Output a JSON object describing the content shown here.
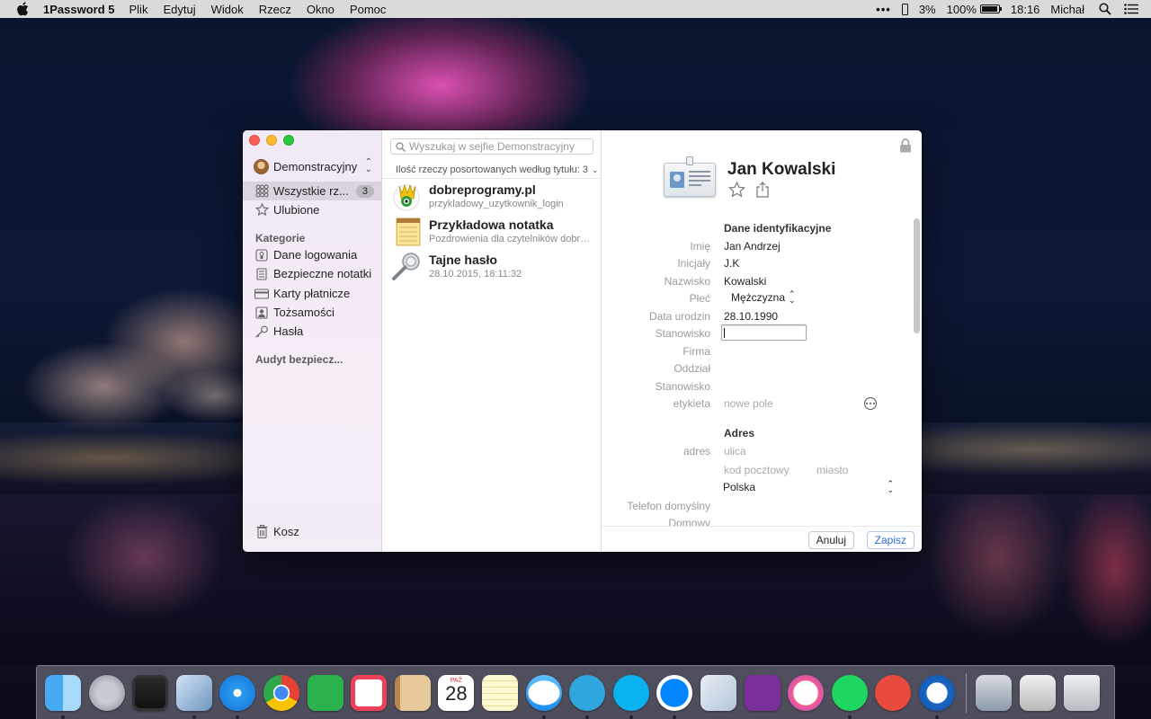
{
  "menubar": {
    "app_name": "1Password 5",
    "items": [
      "Plik",
      "Edytuj",
      "Widok",
      "Rzecz",
      "Okno",
      "Pomoc"
    ],
    "battery_small": "3%",
    "battery_main": "100%",
    "time": "18:16",
    "user": "Michał"
  },
  "sidebar": {
    "vault_name": "Demonstracyjny",
    "all_items_label": "Wszystkie rz...",
    "all_items_count": "3",
    "favorites_label": "Ulubione",
    "categories_heading": "Kategorie",
    "categories": [
      "Dane logowania",
      "Bezpieczne notatki",
      "Karty płatnicze",
      "Tożsamości",
      "Hasła"
    ],
    "audit_heading": "Audyt bezpiecz...",
    "trash_label": "Kosz"
  },
  "list": {
    "search_placeholder": "Wyszukaj w sejfie Demonstracyjny",
    "sort_text": "Ilość rzeczy posortowanych według tytułu: 3",
    "items": [
      {
        "title": "dobreprogramy.pl",
        "subtitle": "przykladowy_uzytkownik_login"
      },
      {
        "title": "Przykładowa notatka",
        "subtitle": "Pozdrowienia dla czytelników dobreprogramy.pl"
      },
      {
        "title": "Tajne hasło",
        "subtitle": "28.10.2015, 18:11:32"
      }
    ]
  },
  "detail": {
    "title": "Jan Kowalski",
    "section_identity": "Dane identyfikacyjne",
    "fields": {
      "imie_label": "Imię",
      "imie_value": "Jan Andrzej",
      "inicjaly_label": "Inicjały",
      "inicjaly_value": "J.K",
      "nazwisko_label": "Nazwisko",
      "nazwisko_value": "Kowalski",
      "plec_label": "Płeć",
      "plec_value": "Mężczyzna",
      "data_label": "Data urodzin",
      "data_value": "28.10.1990",
      "stanowisko_label": "Stanowisko",
      "firma_label": "Firma",
      "oddzial_label": "Oddział",
      "stanowisko2_label": "Stanowisko",
      "etykieta_label": "etykieta",
      "nowe_pole_placeholder": "nowe pole"
    },
    "section_address": "Adres",
    "address": {
      "adres_label": "adres",
      "ulica_placeholder": "ulica",
      "kod_placeholder": "kod pocztowy",
      "miasto_placeholder": "miasto",
      "country": "Polska",
      "telefon_label": "Telefon domyślny",
      "domowy_label": "Domowy"
    },
    "cancel_label": "Anuluj",
    "save_label": "Zapisz"
  },
  "dock": {
    "calendar_month": "PAŹ",
    "calendar_day": "28"
  },
  "colors": {
    "accent": "#2a6fd8",
    "selection": "#c8c2ce"
  }
}
